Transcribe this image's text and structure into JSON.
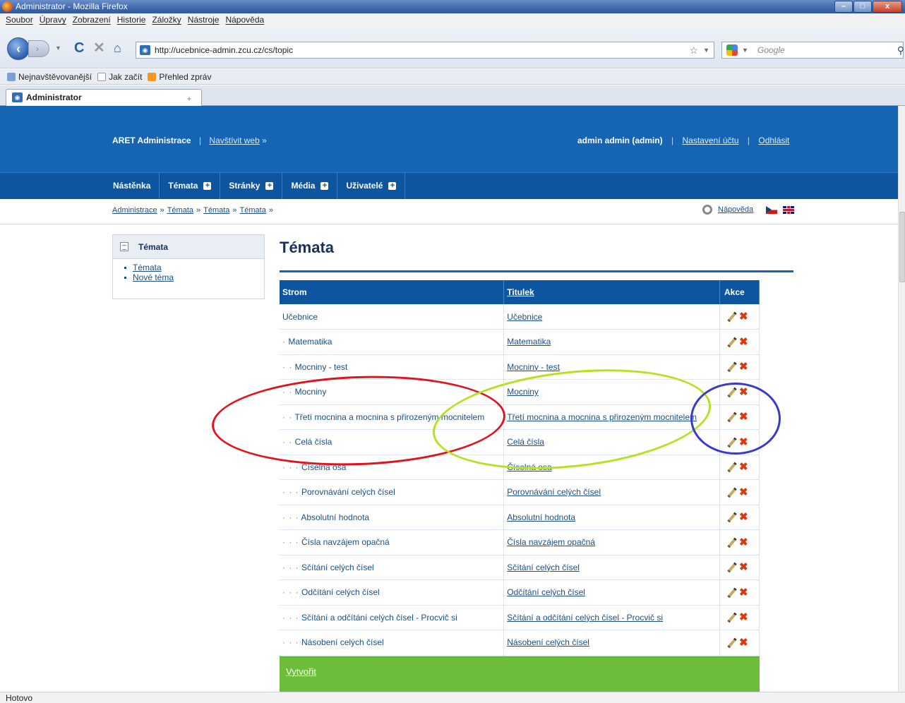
{
  "window": {
    "title": "Administrator - Mozilla Firefox",
    "buttons": {
      "minimize": "–",
      "maximize": "□",
      "close": "x"
    }
  },
  "menu": [
    "Soubor",
    "Úpravy",
    "Zobrazení",
    "Historie",
    "Záložky",
    "Nástroje",
    "Nápověda"
  ],
  "nav": {
    "url": "http://ucebnice-admin.zcu.cz/cs/topic",
    "search_placeholder": "Google"
  },
  "bookmarks": [
    "Nejnavštěvovanější",
    "Jak začít",
    "Přehled zpráv"
  ],
  "tab": {
    "label": "Administrator"
  },
  "header": {
    "brand": "ARET Administrace",
    "visit": "Navštívit web",
    "visit_arrow": "»",
    "user": "admin admin (admin)",
    "settings": "Nastavení účtu",
    "logout": "Odhlásit"
  },
  "mainnav": [
    {
      "label": "Nástěnka",
      "plus": false
    },
    {
      "label": "Témata",
      "plus": true
    },
    {
      "label": "Stránky",
      "plus": true
    },
    {
      "label": "Média",
      "plus": true
    },
    {
      "label": "Uživatelé",
      "plus": true
    }
  ],
  "breadcrumb": [
    "Administrace",
    "Témata",
    "Témata",
    "Témata"
  ],
  "breadcrumb_sep": "»",
  "help": {
    "label": "Nápověda"
  },
  "sidebar": {
    "title": "Témata",
    "links": [
      "Témata",
      "Nové téma"
    ]
  },
  "page_title": "Témata",
  "table": {
    "headers": {
      "tree": "Strom",
      "title": "Titulek",
      "actions": "Akce"
    },
    "rows": [
      {
        "prefix": "",
        "tree": "Učebnice",
        "title": "Učebnice"
      },
      {
        "prefix": "·",
        "tree": "Matematika",
        "title": "Matematika"
      },
      {
        "prefix": "· ·",
        "tree": "Mocniny - test",
        "title": "Mocniny - test"
      },
      {
        "prefix": "· ·",
        "tree": "Mocniny",
        "title": "Mocniny"
      },
      {
        "prefix": "· ·",
        "tree": "Třetí mocnina a mocnina s přirozeným mocnitelem",
        "title": "Třetí mocnina a mocnina s přirozeným mocnitelem"
      },
      {
        "prefix": "· ·",
        "tree": "Celá čísla",
        "title": "Celá čísla"
      },
      {
        "prefix": "· · ·",
        "tree": "Číselná osa",
        "title": "Číselná osa"
      },
      {
        "prefix": "· · ·",
        "tree": "Porovnávání celých čísel",
        "title": "Porovnávání celých čísel"
      },
      {
        "prefix": "· · ·",
        "tree": "Absolutní hodnota",
        "title": "Absolutní hodnota"
      },
      {
        "prefix": "· · ·",
        "tree": "Čísla navzájem opačná",
        "title": "Čísla navzájem opačná"
      },
      {
        "prefix": "· · ·",
        "tree": "Sčítání celých čísel",
        "title": "Sčítání celých čísel"
      },
      {
        "prefix": "· · ·",
        "tree": "Odčítání celých čísel",
        "title": "Odčítání celých čísel"
      },
      {
        "prefix": "· · ·",
        "tree": "Sčítání a odčítání celých čísel - Procvič si",
        "title": "Sčítání a odčítání celých čísel - Procvič si"
      },
      {
        "prefix": "· · ·",
        "tree": "Násobení celých čísel",
        "title": "Násobení celých čísel"
      }
    ]
  },
  "create": {
    "label": "Vytvořit"
  },
  "status": "Hotovo",
  "colors": {
    "header_blue": "#1665b4",
    "nav_blue": "#0e55a0",
    "create_green": "#6cbd3a",
    "annotation_red": "#e0141e",
    "annotation_green": "#b5e21e",
    "annotation_blue": "#3a3ac8"
  }
}
